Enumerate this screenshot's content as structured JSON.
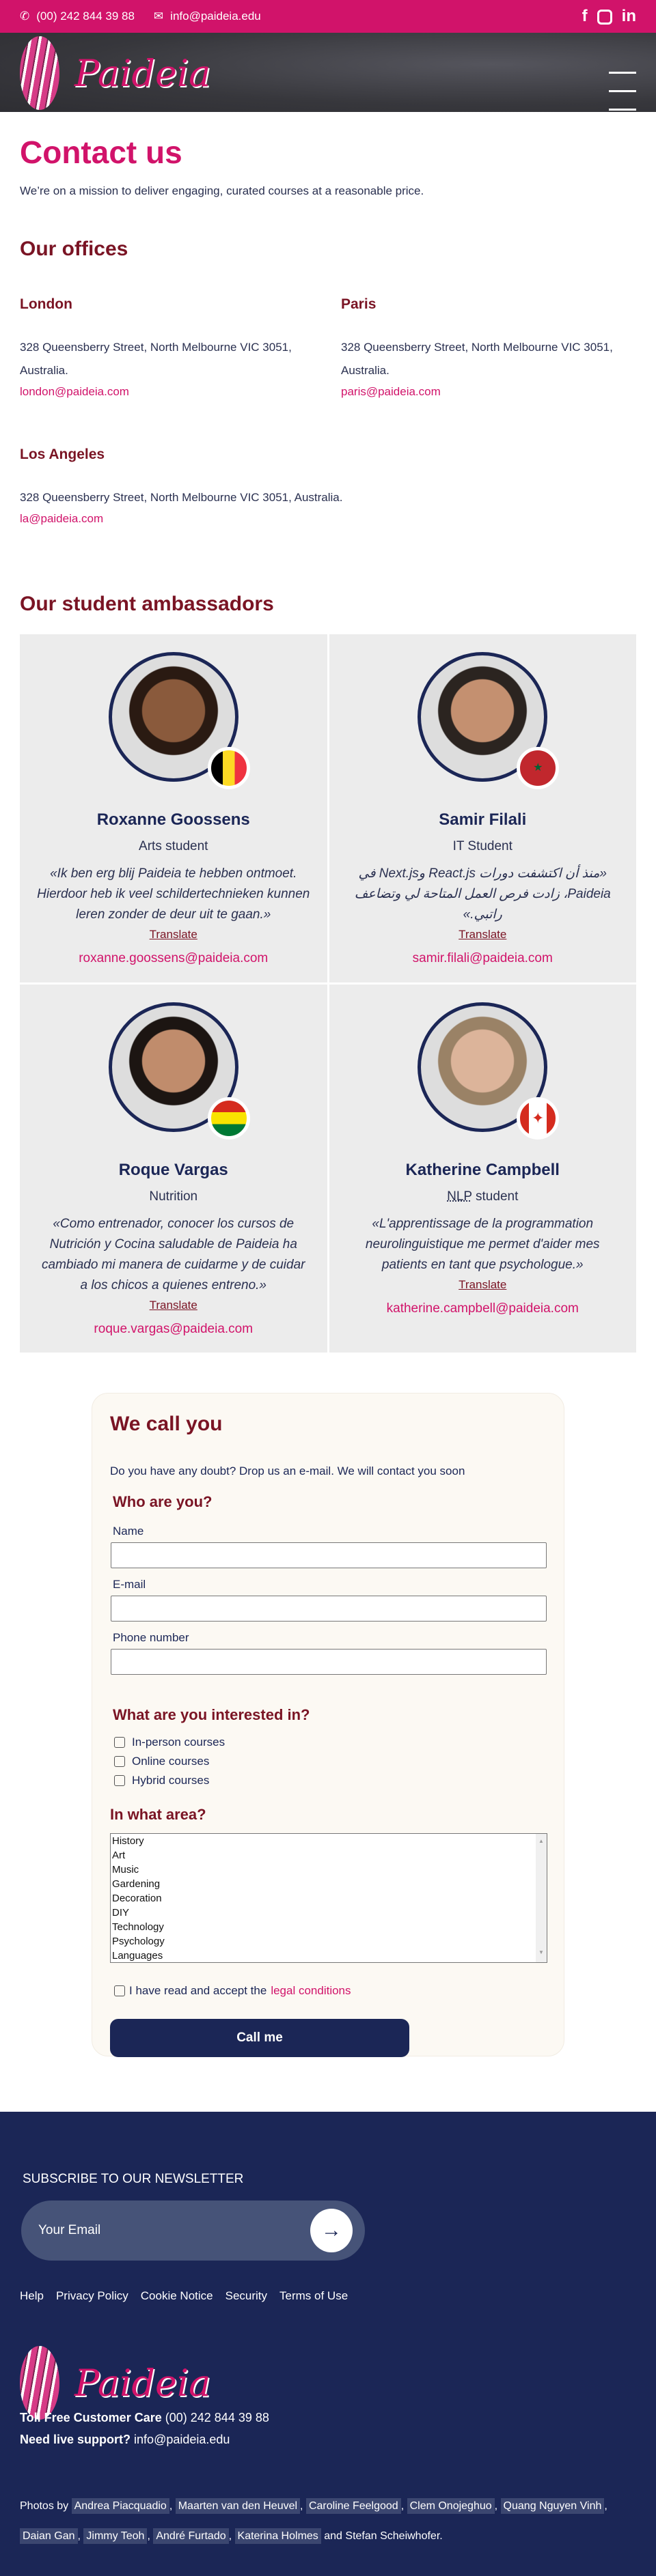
{
  "topbar": {
    "phone": "(00) 242 844 39 88",
    "email": "info@paideia.edu",
    "social": [
      "f",
      "ig",
      "in"
    ]
  },
  "brand": {
    "name": "Paideia"
  },
  "hero": {
    "title": "Contact us",
    "subtitle": "We’re on a mission to deliver engaging, curated courses at a reasonable price."
  },
  "offices": {
    "title": "Our offices",
    "items": [
      {
        "city": "London",
        "address": "328 Queensberry Street, North Melbourne VIC 3051, Australia.",
        "email": "london@paideia.com"
      },
      {
        "city": "Paris",
        "address": "328 Queensberry Street, North Melbourne VIC 3051, Australia.",
        "email": "paris@paideia.com"
      },
      {
        "city": "Los Angeles",
        "address": "328 Queensberry Street, North Melbourne VIC 3051, Australia.",
        "email": "la@paideia.com"
      }
    ]
  },
  "ambassadors": {
    "title": "Our student ambassadors",
    "translate": "Translate",
    "items": [
      {
        "name": "Roxanne Goossens",
        "role": "Arts student",
        "quote": "«Ik ben erg blij Paideia te hebben ontmoet. Hierdoor heb ik veel schildertechnieken kunnen leren zonder de deur uit te gaan.»",
        "email": "roxanne.goossens@paideia.com",
        "flag": "belgium"
      },
      {
        "name": "Samir Filali",
        "role": "IT Student",
        "quote": "«منذ أن اكتشفت دورات React.js وNext.js في Paideia، زادت فرص العمل المتاحة لي وتضاعف راتبي.»",
        "email": "samir.filali@paideia.com",
        "flag": "morocco"
      },
      {
        "name": "Roque Vargas",
        "role": "Nutrition",
        "quote": "«Como entrenador, conocer los cursos de Nutrición y Cocina saludable de Paideia ha cambiado mi manera de cuidarme y de cuidar a los chicos a quienes entreno.»",
        "email": "roque.vargas@paideia.com",
        "flag": "bolivia"
      },
      {
        "name": "Katherine Campbell",
        "role_abbr": "NLP",
        "role": "student",
        "quote": "«L'apprentissage de la programmation neurolinguistique me permet d'aider mes patients en tant que psychologue.»",
        "email": "katherine.campbell@paideia.com",
        "flag": "canada"
      }
    ]
  },
  "form": {
    "title": "We call you",
    "intro": "Do you have any doubt? Drop us an e-mail. We will contact you soon",
    "who": "Who are you?",
    "name_label": "Name",
    "email_label": "E-mail",
    "phone_label": "Phone number",
    "interest": "What are you interested in?",
    "options": [
      "In-person courses",
      "Online courses",
      "Hybrid courses"
    ],
    "area": "In what area?",
    "areas": [
      "History",
      "Art",
      "Music",
      "Gardening",
      "Decoration",
      "DIY",
      "Technology",
      "Psychology",
      "Languages"
    ],
    "legal_prefix": "I have read and accept the",
    "legal_link": "legal conditions",
    "submit": "Call me"
  },
  "footer": {
    "newsletter": "SUBSCRIBE TO OUR NEWSLETTER",
    "email_placeholder": "Your Email",
    "links": [
      "Help",
      "Privacy Policy",
      "Cookie Notice",
      "Security",
      "Terms of Use"
    ],
    "care_label": "Toll Free Customer Care",
    "care_phone": "(00) 242 844 39 88",
    "support_label": "Need live support?",
    "support_email": "info@paideia.edu",
    "photos_prefix": "Photos by",
    "photographers": [
      "Andrea Piacquadio",
      "Maarten van den Heuvel",
      "Caroline Feelgood",
      "Clem Onojeghuo",
      "Quang Nguyen Vinh",
      "Daian Gan",
      "Jimmy Teoh",
      "André Furtado",
      "Katerina Holmes"
    ],
    "photos_suffix": "and Stefan Scheiwhofer."
  }
}
